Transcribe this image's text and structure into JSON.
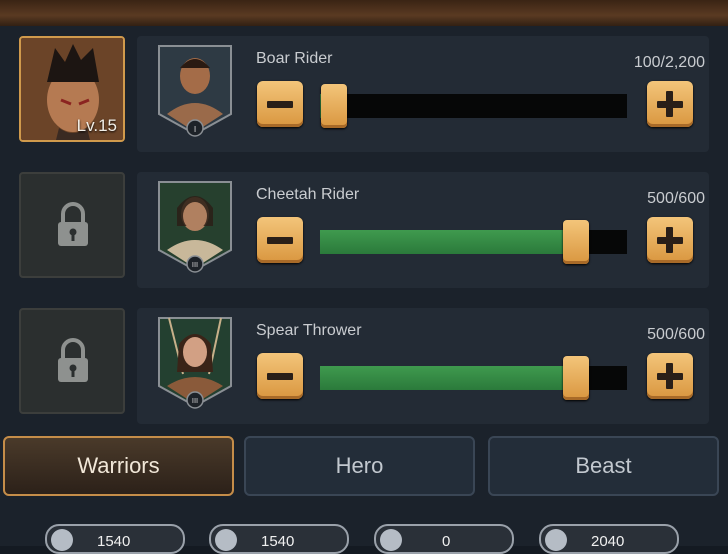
{
  "hero": {
    "level": "Lv.15"
  },
  "units": [
    {
      "name": "Boar Rider",
      "count": "100/2,200",
      "fill": 0.045,
      "tier": "I"
    },
    {
      "name": "Cheetah Rider",
      "count": "500/600",
      "fill": 0.833,
      "tier": "III"
    },
    {
      "name": "Spear Thrower",
      "count": "500/600",
      "fill": 0.833,
      "tier": "III"
    }
  ],
  "tabs": [
    "Warriors",
    "Hero",
    "Beast"
  ],
  "stats": [
    {
      "icon": "bow-icon",
      "value": "1540"
    },
    {
      "icon": "paw-icon",
      "value": "1540"
    },
    {
      "icon": "paw-icon",
      "value": "0"
    },
    {
      "icon": "sword-icon",
      "value": "2040"
    }
  ],
  "colors": {
    "accent": "#d9963f",
    "fill": "#2f8040",
    "panel": "#1b222b"
  }
}
